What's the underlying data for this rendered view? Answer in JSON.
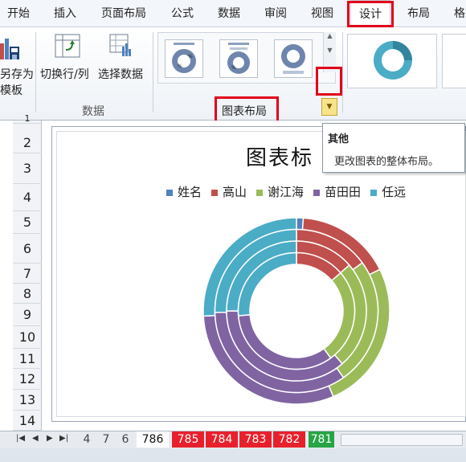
{
  "ribbon_tabs": [
    {
      "label": "开始"
    },
    {
      "label": "插入"
    },
    {
      "label": "页面布局"
    },
    {
      "label": "公式"
    },
    {
      "label": "数据"
    },
    {
      "label": "审阅"
    },
    {
      "label": "视图"
    },
    {
      "label": "设计"
    },
    {
      "label": "布局"
    },
    {
      "label": "格式"
    }
  ],
  "ribbon": {
    "save_as_template_line1": "另存为",
    "save_as_template_line2": "模板",
    "switch_row_col": "切换行/列",
    "select_data": "选择数据",
    "group_data": "数据",
    "group_chart_layouts": "图表布局"
  },
  "tooltip": {
    "title": "其他",
    "description": "更改图表的整体布局。"
  },
  "rows": [
    "1",
    "2",
    "3",
    "4",
    "5",
    "6",
    "7",
    "8",
    "9",
    "10",
    "11",
    "12",
    "13",
    "14"
  ],
  "chart": {
    "title": "图表标",
    "legend": [
      {
        "label": "姓名",
        "color": "#4f81bd"
      },
      {
        "label": "高山",
        "color": "#c0504d"
      },
      {
        "label": "谢江海",
        "color": "#9bbb59"
      },
      {
        "label": "苗田田",
        "color": "#8064a2"
      },
      {
        "label": "任远",
        "color": "#4bacc6"
      }
    ]
  },
  "chart_data": {
    "type": "pie",
    "subtype": "doughnut",
    "title": "图表标",
    "categories": [
      "姓名",
      "高山",
      "谢江海",
      "苗田田",
      "任远"
    ],
    "colors": [
      "#4f81bd",
      "#c0504d",
      "#9bbb59",
      "#8064a2",
      "#4bacc6"
    ],
    "series": [
      {
        "values": [
          1,
          14,
          22,
          26,
          22
        ]
      },
      {
        "values": [
          0,
          13,
          22,
          30,
          22
        ]
      },
      {
        "values": [
          0,
          12,
          22,
          32,
          22
        ]
      },
      {
        "values": [
          0,
          13,
          25,
          32,
          25
        ]
      }
    ],
    "legend_position": "top"
  },
  "sheet_tabs": [
    {
      "label": "4"
    },
    {
      "label": "7"
    },
    {
      "label": "6"
    },
    {
      "label": "786"
    },
    {
      "label": "785"
    },
    {
      "label": "784"
    },
    {
      "label": "783"
    },
    {
      "label": "782"
    },
    {
      "label": "781"
    }
  ]
}
